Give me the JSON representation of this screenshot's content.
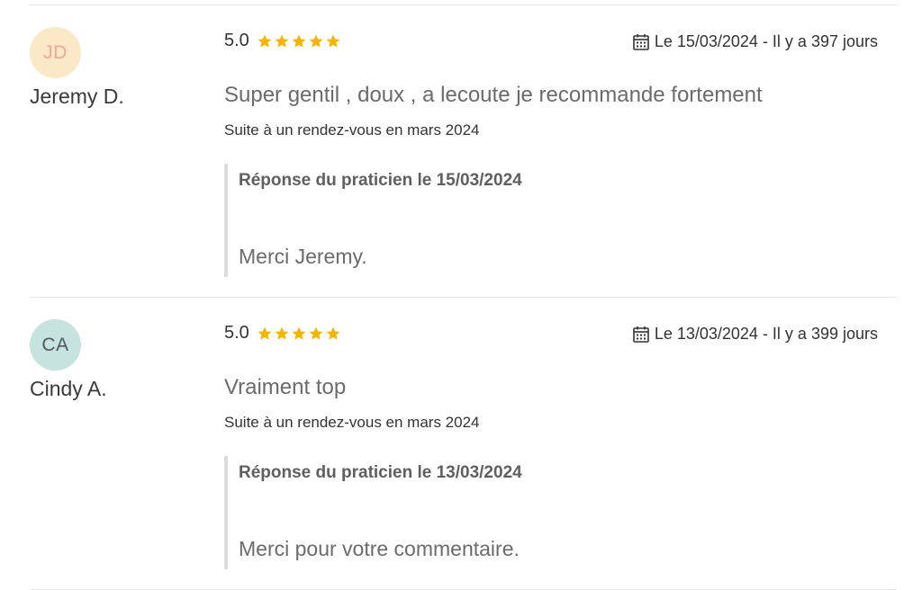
{
  "reviews": [
    {
      "initials": "JD",
      "avatar_bg": "#fbe8c6",
      "avatar_fg": "#f0a896",
      "author": "Jeremy D.",
      "rating_value": "5.0",
      "stars": 5,
      "date_text": "Le 15/03/2024 - Il y a 397 jours",
      "comment": "Super gentil , doux , a lecoute je recommande fortement",
      "context": "Suite à un rendez-vous en mars 2024",
      "reply_title": "Réponse du praticien le 15/03/2024",
      "reply_text": "Merci Jeremy."
    },
    {
      "initials": "CA",
      "avatar_bg": "#c6e3e0",
      "avatar_fg": "#4f5a60",
      "author": "Cindy A.",
      "rating_value": "5.0",
      "stars": 5,
      "date_text": "Le 13/03/2024 - Il y a 399 jours",
      "comment": "Vraiment top",
      "context": "Suite à un rendez-vous en mars 2024",
      "reply_title": "Réponse du praticien le 13/03/2024",
      "reply_text": "Merci pour votre commentaire."
    }
  ],
  "colors": {
    "star": "#f5b400",
    "divider": "#e6e6e6",
    "reply_border": "#dcdcdc"
  },
  "icons": {
    "star": "star-icon",
    "calendar": "calendar-icon"
  }
}
